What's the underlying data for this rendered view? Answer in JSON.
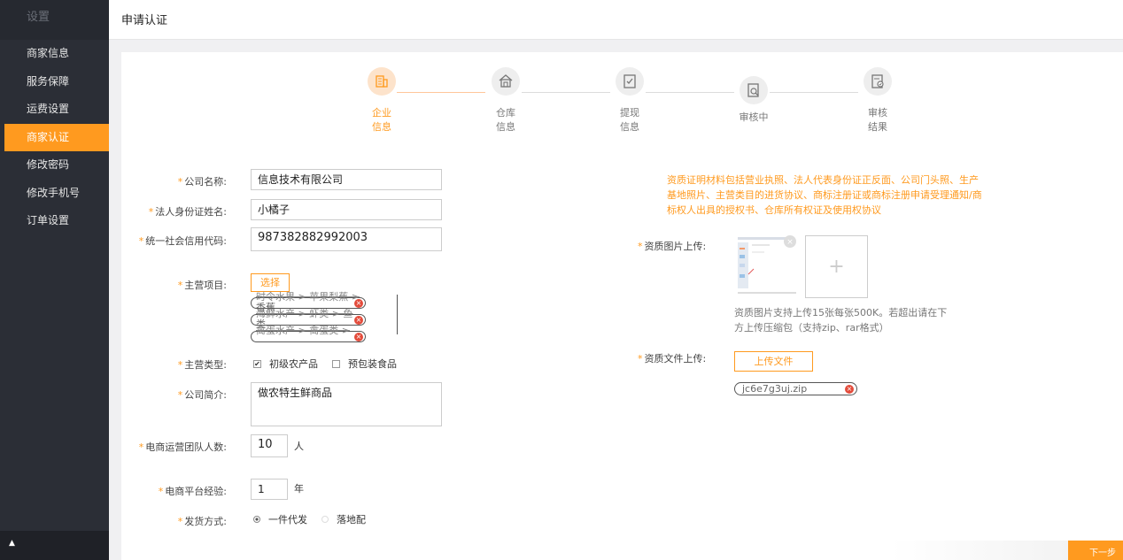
{
  "sidebar": {
    "header": "设置",
    "items": [
      {
        "label": "商家信息"
      },
      {
        "label": "服务保障"
      },
      {
        "label": "运费设置"
      },
      {
        "label": "商家认证"
      },
      {
        "label": "修改密码"
      },
      {
        "label": "修改手机号"
      },
      {
        "label": "订单设置"
      }
    ],
    "active_index": 3,
    "footer_icon": "caret-up-icon"
  },
  "topbar": {
    "title": "申请认证"
  },
  "steps": [
    {
      "label": "企业信息",
      "icon": "building-icon",
      "active": true
    },
    {
      "label": "仓库信息",
      "icon": "warehouse-icon",
      "active": false
    },
    {
      "label": "提现信息",
      "icon": "checklist-icon",
      "active": false
    },
    {
      "label": "审核中",
      "icon": "search-document-icon",
      "active": false
    },
    {
      "label": "审核结果",
      "icon": "result-document-icon",
      "active": false
    }
  ],
  "form": {
    "company_name": {
      "label": "公司名称:",
      "value": "信息技术有限公司"
    },
    "legal_name": {
      "label": "法人身份证姓名:",
      "value": "小橘子"
    },
    "credit_code": {
      "label": "统一社会信用代码:",
      "value": "987382882992003"
    },
    "main_items": {
      "label": "主营项目:",
      "select_label": "选择",
      "tags": [
        {
          "text": "时令水果 > 苹果梨蕉 >",
          "text2": "香蕉"
        },
        {
          "text": "海鲜水产 > 虾类 > 鱼",
          "text2": "类"
        },
        {
          "text": "禽蛋水产 > 禽蛋类 >",
          "text2": ""
        }
      ]
    },
    "main_type": {
      "label": "主营类型:",
      "options": [
        {
          "label": "初级农产品",
          "checked": true
        },
        {
          "label": "预包装食品",
          "checked": false
        }
      ]
    },
    "intro": {
      "label": "公司简介:",
      "value": "做农特生鲜商品"
    },
    "team": {
      "label": "电商运营团队人数:",
      "value": "10",
      "unit": "人"
    },
    "experience": {
      "label": "电商平台经验:",
      "value": "1",
      "unit": "年"
    },
    "shipping": {
      "label": "发货方式:",
      "options": [
        {
          "label": "一件代发",
          "selected": true
        },
        {
          "label": "落地配",
          "selected": false
        }
      ]
    }
  },
  "right": {
    "note": "资质证明材料包括营业执照、法人代表身份证正反面、公司门头照、生产基地照片、主营类目的进货协议、商标注册证或商标注册申请受理通知/商标权人出具的授权书、仓库所有权证及使用权协议",
    "image_upload": {
      "label": "资质图片上传:",
      "hint": "资质图片支持上传15张每张500K。若超出请在下方上传压缩包（支持zip、rar格式）"
    },
    "file_upload": {
      "label": "资质文件上传:",
      "button": "上传文件",
      "file_name": "jc6e7g3uj.zip"
    }
  },
  "next_button": "下一步",
  "colors": {
    "accent": "#ff9a1f",
    "sidebar": "#2b2e36",
    "remove": "#e34b3b"
  }
}
